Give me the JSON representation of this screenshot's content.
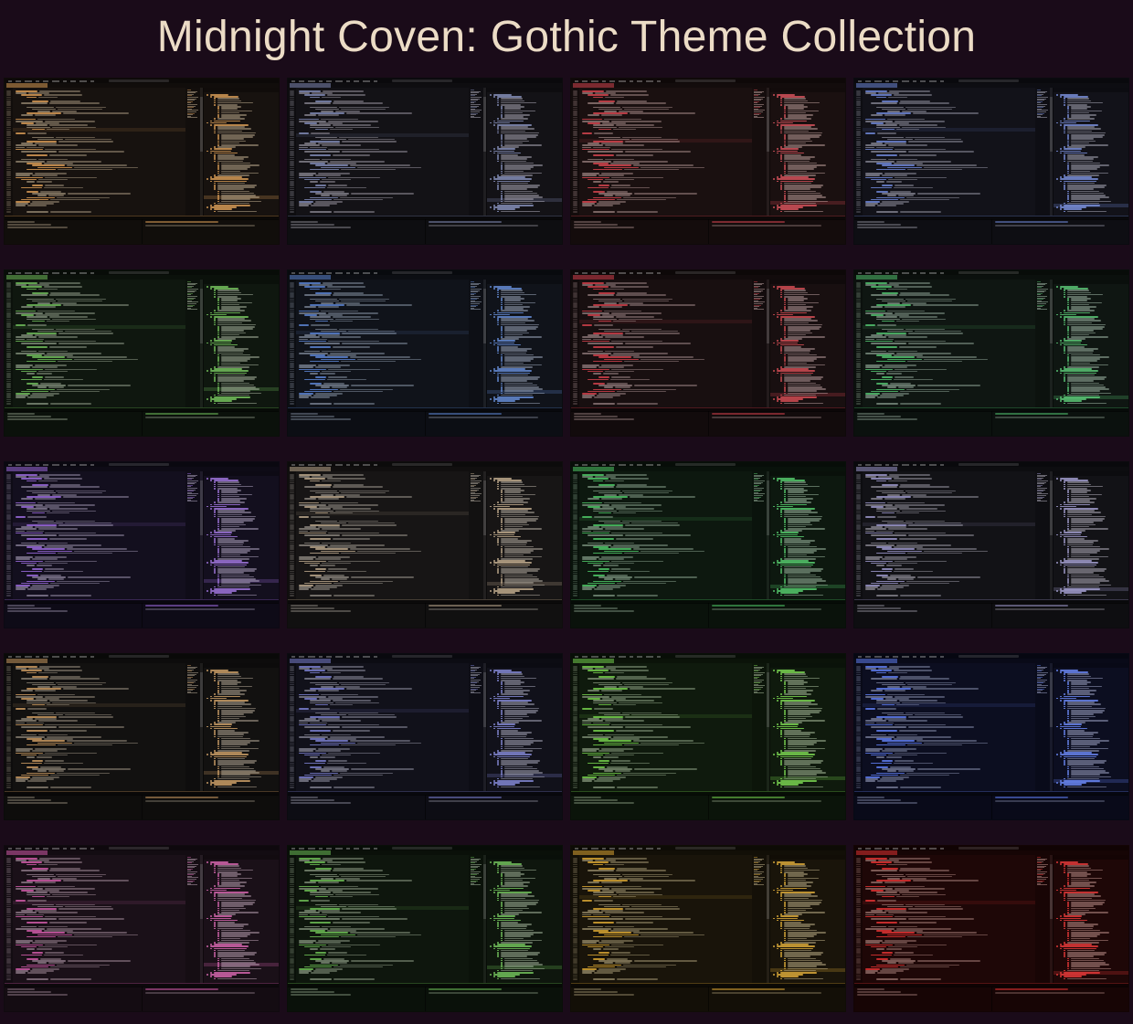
{
  "title": "Midnight Coven: Gothic Theme Collection",
  "themes": [
    {
      "bg": "#17120f",
      "accent": "#d79a55",
      "text": "#cbb89a",
      "tree": "#e0a35a"
    },
    {
      "bg": "#131216",
      "accent": "#7f88b3",
      "text": "#b9b6c4",
      "tree": "#8c96c2"
    },
    {
      "bg": "#1a1010",
      "accent": "#d2444e",
      "text": "#c9a9a6",
      "tree": "#e05660"
    },
    {
      "bg": "#121219",
      "accent": "#6e86d6",
      "text": "#b6b6c6",
      "tree": "#7f96e4"
    },
    {
      "bg": "#0f170f",
      "accent": "#6fba5a",
      "text": "#b5c2ab",
      "tree": "#7acc62"
    },
    {
      "bg": "#10131a",
      "accent": "#5b83d0",
      "text": "#a8b4c8",
      "tree": "#6a93e0"
    },
    {
      "bg": "#180f10",
      "accent": "#cf3f4a",
      "text": "#c3a7a7",
      "tree": "#dd5058"
    },
    {
      "bg": "#0f1612",
      "accent": "#52c06e",
      "text": "#aec6b4",
      "tree": "#5fd07c"
    },
    {
      "bg": "#130f1e",
      "accent": "#9a6adb",
      "text": "#bbb0cc",
      "tree": "#a87be6"
    },
    {
      "bg": "#171515",
      "accent": "#b9a58a",
      "text": "#c1b9ae",
      "tree": "#c9b393"
    },
    {
      "bg": "#0d180f",
      "accent": "#4fc566",
      "text": "#a9c6ad",
      "tree": "#5ad472"
    },
    {
      "bg": "#121216",
      "accent": "#9b96c9",
      "text": "#bdbac8",
      "tree": "#aaa5d8"
    },
    {
      "bg": "#121110",
      "accent": "#c99960",
      "text": "#c0b4a0",
      "tree": "#d6a66b"
    },
    {
      "bg": "#11111a",
      "accent": "#7a7fcf",
      "text": "#b4b4c6",
      "tree": "#8a8fde"
    },
    {
      "bg": "#0f1a0d",
      "accent": "#74cf4c",
      "text": "#b3c7a6",
      "tree": "#80de55"
    },
    {
      "bg": "#0c0e20",
      "accent": "#5f7df0",
      "text": "#a7aed0",
      "tree": "#6f8dfc"
    },
    {
      "bg": "#1a1018",
      "accent": "#d05aa8",
      "text": "#c3aabb",
      "tree": "#de6ab6"
    },
    {
      "bg": "#0e160d",
      "accent": "#6cbc55",
      "text": "#b0c2a7",
      "tree": "#78ca60"
    },
    {
      "bg": "#19140a",
      "accent": "#d8a433",
      "text": "#c9b990",
      "tree": "#e6b23c"
    },
    {
      "bg": "#1e0707",
      "accent": "#e03232",
      "text": "#c79a94",
      "tree": "#ee3c3c"
    }
  ]
}
